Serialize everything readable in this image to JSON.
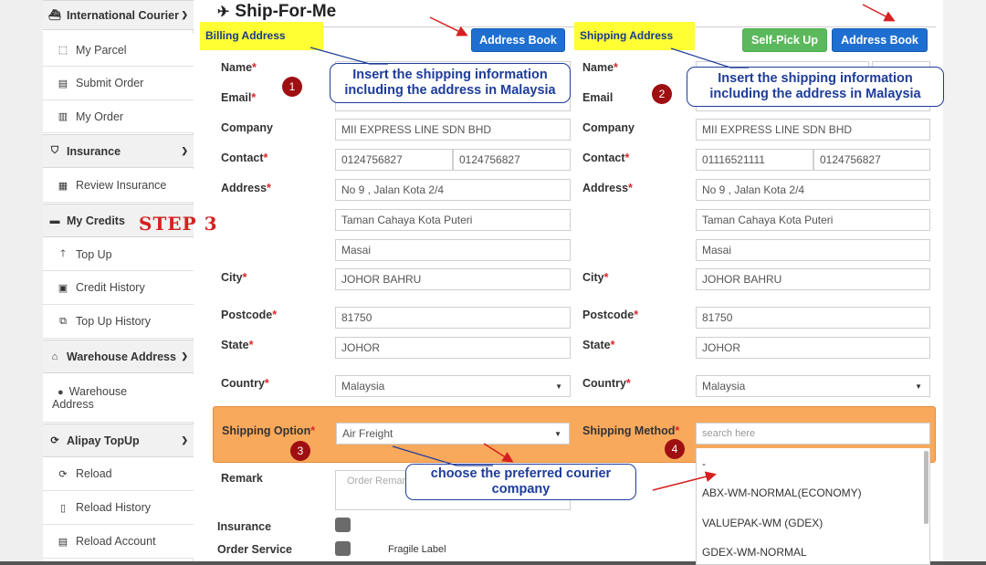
{
  "sidebar": {
    "international_courier": "International Courier",
    "my_parcel": "My Parcel",
    "submit_order": "Submit Order",
    "my_order": "My Order",
    "insurance": "Insurance",
    "review_insurance": "Review Insurance",
    "my_credits": "My Credits",
    "top_up": "Top Up",
    "credit_history": "Credit History",
    "top_up_history": "Top Up History",
    "warehouse_address_head": "Warehouse Address",
    "warehouse_line1": "Warehouse",
    "warehouse_line2": "Address",
    "alipay_topup": "Alipay TopUp",
    "reload": "Reload",
    "reload_history": "Reload History",
    "reload_account": "Reload Account"
  },
  "step_label": "STEP 3",
  "page": {
    "title": "Ship-For-Me"
  },
  "billing": {
    "header": "Billing Address",
    "address_book": "Address Book",
    "labels": {
      "name": "Name",
      "email": "Email",
      "company": "Company",
      "contact": "Contact",
      "address": "Address",
      "city": "City",
      "postcode": "Postcode",
      "state": "State",
      "country": "Country"
    },
    "values": {
      "company": "MII EXPRESS LINE SDN BHD",
      "contact1": "0124756827",
      "contact2": "0124756827",
      "address1": "No 9 , Jalan Kota 2/4",
      "address2": "Taman Cahaya Kota Puteri",
      "address3": "Masai",
      "city": "JOHOR BAHRU",
      "postcode": "81750",
      "state": "JOHOR",
      "country": "Malaysia"
    }
  },
  "shipping": {
    "header": "Shipping Address",
    "self_pickup": "Self-Pick Up",
    "address_book": "Address Book",
    "labels": {
      "name": "Name",
      "email": "Email",
      "company": "Company",
      "contact": "Contact",
      "address": "Address",
      "city": "City",
      "postcode": "Postcode",
      "state": "State",
      "country": "Country"
    },
    "values": {
      "company": "MII EXPRESS LINE SDN BHD",
      "contact1": "01116521111",
      "contact2": "0124756827",
      "address1": "No 9 , Jalan Kota 2/4",
      "address2": "Taman Cahaya Kota Puteri",
      "address3": "Masai",
      "city": "JOHOR BAHRU",
      "postcode": "81750",
      "state": "JOHOR",
      "country": "Malaysia"
    }
  },
  "options": {
    "shipping_option_label": "Shipping Option",
    "shipping_option_value": "Air Freight",
    "shipping_method_label": "Shipping Method",
    "search_placeholder": "search here",
    "methods": [
      "-",
      "ABX-WM-NORMAL(ECONOMY)",
      "VALUEPAK-WM (GDEX)",
      "GDEX-WM-NORMAL"
    ]
  },
  "remark": {
    "label": "Remark",
    "placeholder": "Order Remark"
  },
  "insurance_label": "Insurance",
  "order_service": {
    "label": "Order Service",
    "fragile": "Fragile Label"
  },
  "annotations": {
    "callout1_line1": "Insert the shipping information",
    "callout1_line2": "including the address in Malaysia",
    "callout2_line1": "Insert the shipping information",
    "callout2_line2": "including the address in Malaysia",
    "callout3_line1": "choose the preferred courier",
    "callout3_line2": "company",
    "badges": [
      "1",
      "2",
      "3",
      "4"
    ]
  },
  "colors": {
    "accent_blue": "#1f6fd1",
    "green": "#5cb85c",
    "highlight_yellow": "#ffff33",
    "orange_panel": "#f9a95c",
    "badge_red": "#9e0f12",
    "callout_blue": "#1d3c9a",
    "step_red": "#d62020"
  }
}
